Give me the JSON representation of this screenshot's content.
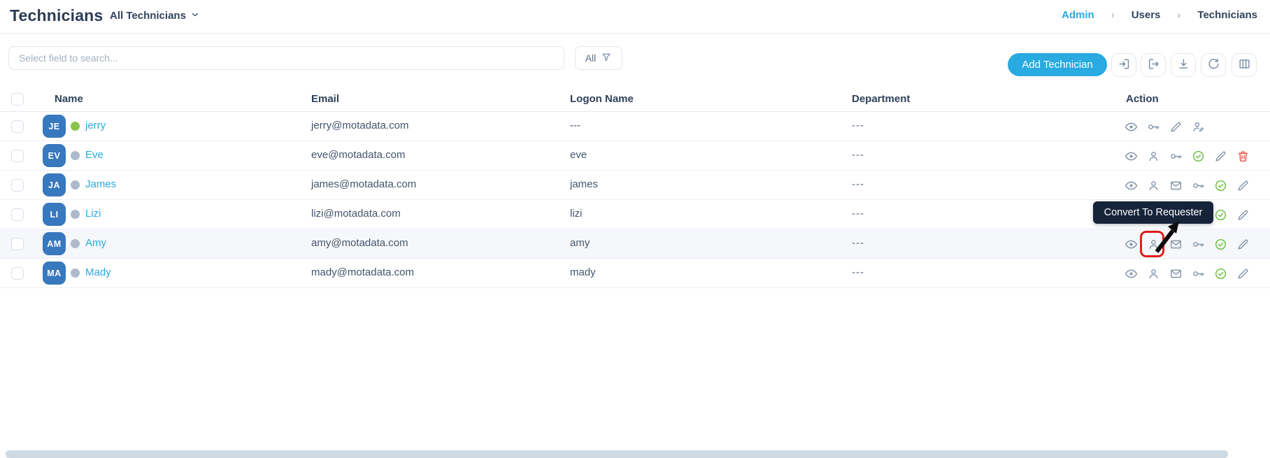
{
  "page": {
    "title": "Technicians",
    "view_selector": "All Technicians"
  },
  "breadcrumb": {
    "items": [
      "Admin",
      "Users",
      "Technicians"
    ],
    "active_item": "Admin"
  },
  "toolbar": {
    "search_placeholder": "Select field to search...",
    "filter_label": "All",
    "add_button_label": "Add Technician",
    "icon_buttons": [
      "import-icon",
      "export-icon",
      "download-icon",
      "refresh-icon",
      "columns-icon"
    ]
  },
  "table": {
    "headers": {
      "name": "Name",
      "email": "Email",
      "logon": "Logon Name",
      "department": "Department",
      "action": "Action"
    },
    "rows": [
      {
        "initials": "JE",
        "name": "jerry",
        "status": "available",
        "email": "jerry@motadata.com",
        "logon_name": "---",
        "department": "---",
        "actions": [
          "view",
          "reset-password",
          "edit",
          "convert-to-technician"
        ]
      },
      {
        "initials": "EV",
        "name": "Eve",
        "status": "offline",
        "email": "eve@motadata.com",
        "logon_name": "eve",
        "department": "---",
        "actions": [
          "view",
          "convert-to-requester",
          "reset-password",
          "verified",
          "edit",
          "delete"
        ]
      },
      {
        "initials": "JA",
        "name": "James",
        "status": "offline",
        "email": "james@motadata.com",
        "logon_name": "james",
        "department": "---",
        "actions": [
          "view",
          "convert-to-requester",
          "send-email",
          "reset-password",
          "verified",
          "edit"
        ]
      },
      {
        "initials": "LI",
        "name": "Lizi",
        "status": "offline",
        "email": "lizi@motadata.com",
        "logon_name": "lizi",
        "department": "---",
        "actions": [
          "view",
          "convert-to-requester",
          "send-email",
          "reset-password",
          "verified",
          "edit"
        ]
      },
      {
        "initials": "AM",
        "name": "Amy",
        "status": "offline",
        "email": "amy@motadata.com",
        "logon_name": "amy",
        "department": "---",
        "actions": [
          "view",
          "convert-to-requester",
          "send-email",
          "reset-password",
          "verified",
          "edit"
        ],
        "highlighted": true
      },
      {
        "initials": "MA",
        "name": "Mady",
        "status": "offline",
        "email": "mady@motadata.com",
        "logon_name": "mady",
        "department": "---",
        "actions": [
          "view",
          "convert-to-requester",
          "send-email",
          "reset-password",
          "verified",
          "edit"
        ]
      }
    ]
  },
  "tooltip": {
    "text": "Convert To Requester"
  },
  "colors": {
    "accent": "#29aae1",
    "avatar_bg": "#3778be",
    "status_available": "#8bc34a",
    "status_offline": "#aebacb",
    "verified_green": "#6abf3f",
    "delete_red": "#e8564a",
    "annotation_red": "#e11d1d",
    "tooltip_bg": "#16243a",
    "heading": "#2b3c55"
  }
}
